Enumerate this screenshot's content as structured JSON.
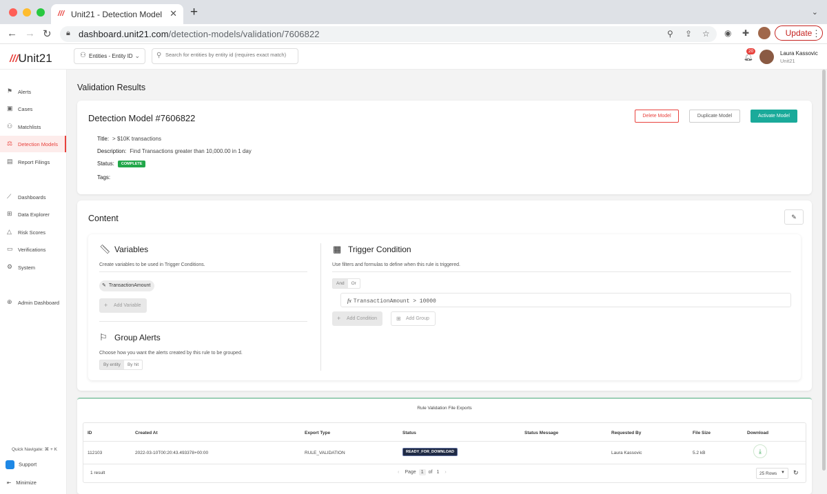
{
  "browser": {
    "tab_title": "Unit21 - Detection Model",
    "tab_close": "✕",
    "new_tab": "+",
    "url_host": "dashboard.unit21.com",
    "url_path": "/detection-models/validation/7606822",
    "update_label": "Update"
  },
  "header": {
    "logo_mark": "///",
    "logo_text": "Unit21",
    "entity_select": "Entities - Entity ID",
    "search_placeholder": "Search for entities by entity id (requires exact match)",
    "notification_count": "20",
    "user_name": "Laura Kassovic",
    "user_org": "Unit21"
  },
  "sidebar": {
    "items": [
      {
        "label": "Alerts",
        "icon": "⚑"
      },
      {
        "label": "Cases",
        "icon": "▣"
      },
      {
        "label": "Matchlists",
        "icon": "⚇"
      },
      {
        "label": "Detection Models",
        "icon": "⚖"
      },
      {
        "label": "Report Filings",
        "icon": "▤"
      },
      {
        "label": "Dashboards",
        "icon": "⟋"
      },
      {
        "label": "Data Explorer",
        "icon": "⊞"
      },
      {
        "label": "Risk Scores",
        "icon": "△"
      },
      {
        "label": "Verifications",
        "icon": "▭"
      },
      {
        "label": "System",
        "icon": "⚙"
      },
      {
        "label": "Admin Dashboard",
        "icon": "⊕"
      }
    ],
    "quick_navigate": "Quick Navigate: ⌘ + K",
    "support": "Support",
    "minimize": "Minimize"
  },
  "page": {
    "title": "Validation Results"
  },
  "model": {
    "title": "Detection Model #7606822",
    "delete_label": "Delete Model",
    "duplicate_label": "Duplicate Model",
    "activate_label": "Activate Model",
    "title_key": "Title:",
    "title_value": "> $10K transactions",
    "description_key": "Description:",
    "description_value": "Find Transactions greater than 10,000.00 in 1 day",
    "status_key": "Status:",
    "status_value": "COMPLETE",
    "tags_key": "Tags:"
  },
  "content": {
    "title": "Content",
    "variables_title": "Variables",
    "variables_desc": "Create variables to be used in Trigger Conditions.",
    "variable_chip": "TransactionAmount",
    "add_variable": "Add Variable",
    "group_title": "Group Alerts",
    "group_desc": "Choose how you want the alerts created by this rule to be grouped.",
    "group_by_entity": "By entity",
    "group_by_hit": "By hit",
    "trigger_title": "Trigger Condition",
    "trigger_desc": "Use filters and formulas to define when this rule is triggered.",
    "and_label": "And",
    "or_label": "Or",
    "condition": "TransactionAmount > 10000",
    "fx": "fx",
    "add_condition": "Add Condition",
    "add_group": "Add Group"
  },
  "exports": {
    "title": "Rule Validation File Exports",
    "columns": [
      "ID",
      "Created At",
      "Export Type",
      "Status",
      "Status Message",
      "Requested By",
      "File Size",
      "Download"
    ],
    "row": {
      "id": "112103",
      "created_at": "2022-03-10T00:20:43.493378+00:00",
      "export_type": "RULE_VALIDATION",
      "status": "READY_FOR_DOWNLOAD",
      "status_message": "",
      "requested_by": "Laura Kassovic",
      "file_size": "5.2 kB"
    },
    "result_count": "1 result",
    "page_label": "Page",
    "page_current": "1",
    "page_of": "of",
    "page_total": "1",
    "rows_per_page": "25 Rows"
  },
  "colors": {
    "accent": "#e8413c",
    "activate": "#1aaa9a",
    "status_complete": "#22a74a"
  }
}
